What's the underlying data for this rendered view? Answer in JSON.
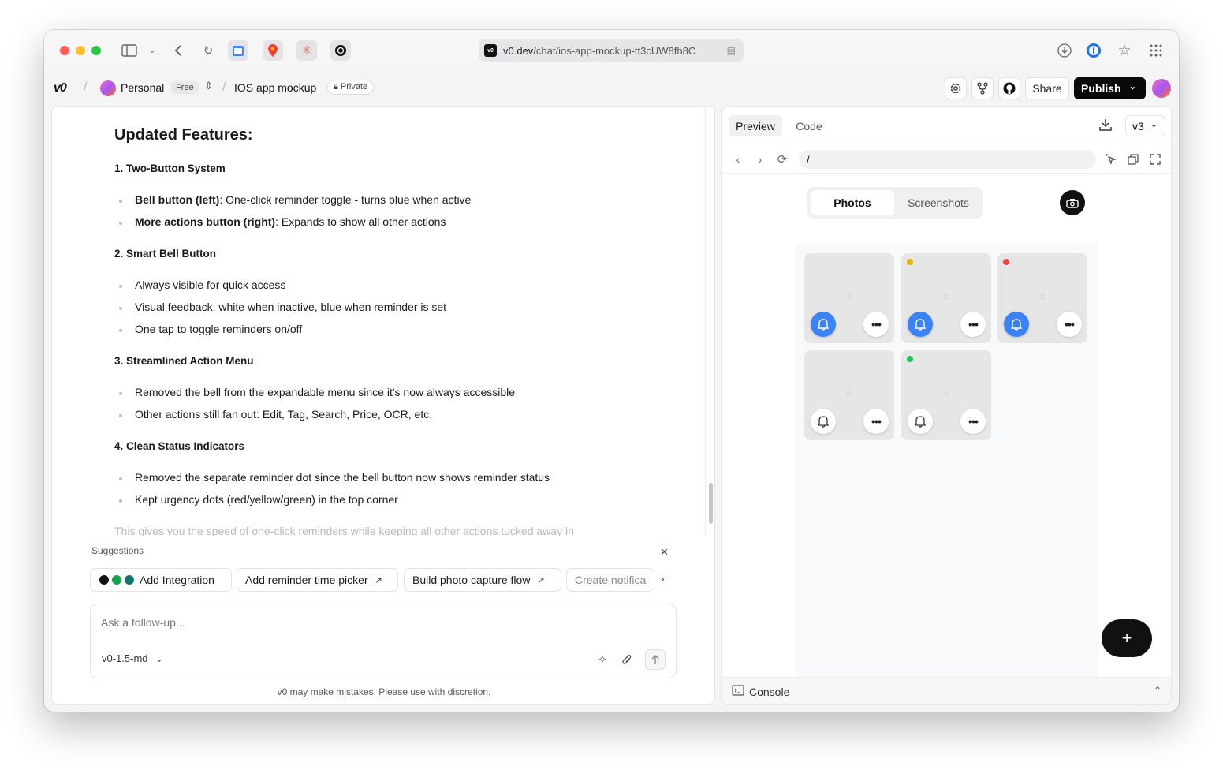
{
  "browser": {
    "url_domain": "v0.dev",
    "url_path": "/chat/ios-app-mockup-tt3cUW8fh8C",
    "favicon_text": "v0"
  },
  "header": {
    "logo": "v0",
    "workspace": "Personal",
    "plan": "Free",
    "project": "IOS app mockup",
    "visibility": "Private",
    "share_label": "Share",
    "publish_label": "Publish"
  },
  "chat": {
    "heading": "Updated Features:",
    "sections": [
      {
        "title": "1. Two-Button System",
        "bullets": [
          {
            "bold": "Bell button (left)",
            "text": ": One-click reminder toggle - turns blue when active"
          },
          {
            "bold": "More actions button (right)",
            "text": ": Expands to show all other actions"
          }
        ]
      },
      {
        "title": "2. Smart Bell Button",
        "bullets": [
          {
            "bold": "",
            "text": "Always visible for quick access"
          },
          {
            "bold": "",
            "text": "Visual feedback: white when inactive, blue when reminder is set"
          },
          {
            "bold": "",
            "text": "One tap to toggle reminders on/off"
          }
        ]
      },
      {
        "title": "3. Streamlined Action Menu",
        "bullets": [
          {
            "bold": "",
            "text": "Removed the bell from the expandable menu since it's now always accessible"
          },
          {
            "bold": "",
            "text": "Other actions still fan out: Edit, Tag, Search, Price, OCR, etc."
          }
        ]
      },
      {
        "title": "4. Clean Status Indicators",
        "bullets": [
          {
            "bold": "",
            "text": "Removed the separate reminder dot since the bell button now shows reminder status"
          },
          {
            "bold": "",
            "text": "Kept urgency dots (red/yellow/green) in the top corner"
          }
        ]
      }
    ],
    "fade_line": "This gives you the speed of one-click reminders while keeping all other actions tucked away in",
    "suggestions_label": "Suggestions",
    "suggestions": [
      "Add Integration",
      "Add reminder time picker",
      "Build photo capture flow",
      "Create notifica"
    ],
    "input_placeholder": "Ask a follow-up...",
    "model": "v0-1.5-md",
    "disclaimer": "v0 may make mistakes. Please use with discretion."
  },
  "preview": {
    "tabs": [
      "Preview",
      "Code"
    ],
    "version": "v3",
    "address": "/",
    "segments": [
      "Photos",
      "Screenshots"
    ],
    "tiles": [
      {
        "urgency": "none",
        "reminder": true
      },
      {
        "urgency": "yellow",
        "reminder": true
      },
      {
        "urgency": "red",
        "reminder": true
      },
      {
        "urgency": "none",
        "reminder": false
      },
      {
        "urgency": "green",
        "reminder": false
      }
    ],
    "fab": "+",
    "console_label": "Console"
  },
  "colors": {
    "accent_blue": "#3b82f6",
    "urgency_red": "#ef4444",
    "urgency_yellow": "#eab308",
    "urgency_green": "#22c55e"
  }
}
